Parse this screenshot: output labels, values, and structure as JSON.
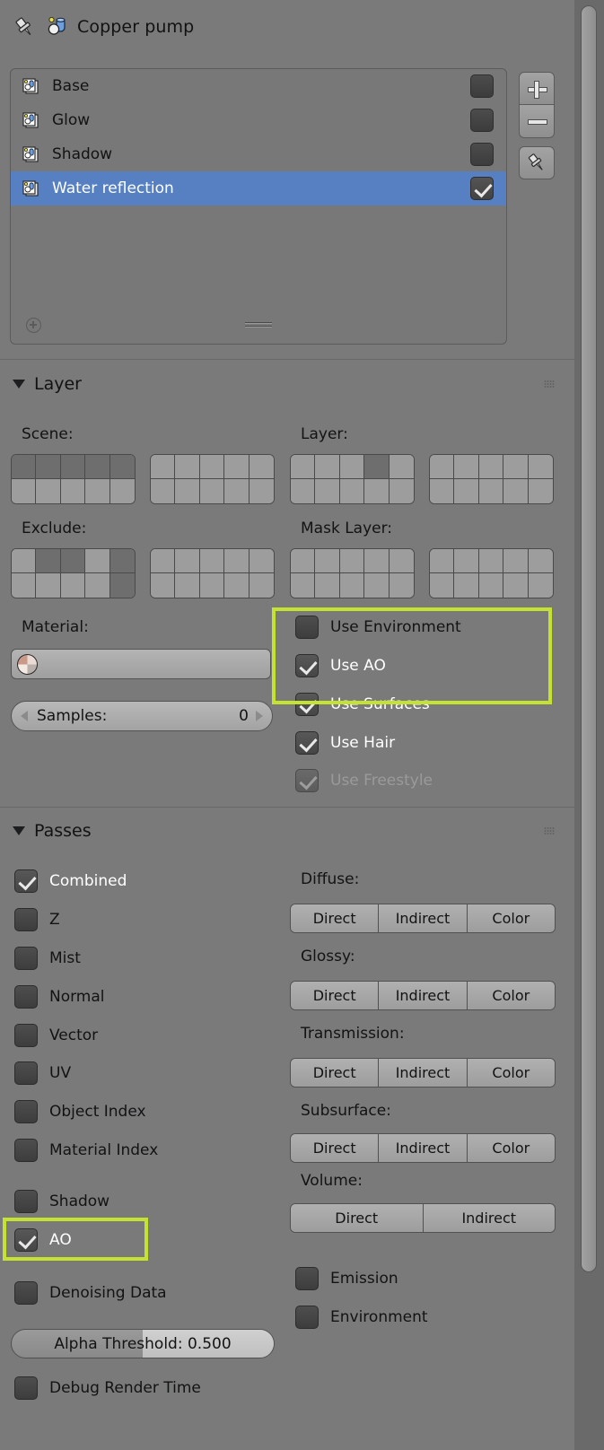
{
  "header": {
    "title": "Copper pump",
    "pin_icon": "pin-icon",
    "scene_icon": "render-layers-icon"
  },
  "render_layers": {
    "items": [
      {
        "name": "Base",
        "icon": "render-layer-icon",
        "enabled": false,
        "selected": false
      },
      {
        "name": "Glow",
        "icon": "render-layer-icon",
        "enabled": false,
        "selected": false
      },
      {
        "name": "Shadow",
        "icon": "render-layer-icon",
        "enabled": false,
        "selected": false
      },
      {
        "name": "Water reflection",
        "icon": "render-layer-icon",
        "enabled": true,
        "selected": true
      }
    ],
    "side_buttons": [
      {
        "label": "+",
        "name": "add-render-layer-button"
      },
      {
        "label": "−",
        "name": "remove-render-layer-button"
      },
      {
        "label": "",
        "name": "pin-render-layer-button"
      }
    ],
    "filter_icon": "filter-plus-icon",
    "resize_grip": "resize-grip"
  },
  "layer_panel": {
    "title": "Layer",
    "expanded": true,
    "groups": [
      {
        "label": "Scene:",
        "name": "scene-layers",
        "blocks": [
          {
            "cells": [
              true,
              true,
              true,
              true,
              true,
              false,
              false,
              false,
              false,
              false
            ]
          },
          {
            "cells": [
              false,
              false,
              false,
              false,
              false,
              false,
              false,
              false,
              false,
              false
            ]
          }
        ]
      },
      {
        "label": "Layer:",
        "name": "layer-layers",
        "blocks": [
          {
            "cells": [
              false,
              false,
              false,
              true,
              false,
              false,
              false,
              false,
              false,
              false
            ]
          },
          {
            "cells": [
              false,
              false,
              false,
              false,
              false,
              false,
              false,
              false,
              false,
              false
            ]
          }
        ]
      },
      {
        "label": "Exclude:",
        "name": "exclude-layers",
        "blocks": [
          {
            "cells": [
              false,
              true,
              true,
              false,
              true,
              false,
              false,
              false,
              false,
              true
            ]
          },
          {
            "cells": [
              false,
              false,
              false,
              false,
              false,
              false,
              false,
              false,
              false,
              false
            ]
          }
        ]
      },
      {
        "label": "Mask Layer:",
        "name": "mask-layers",
        "blocks": [
          {
            "cells": [
              false,
              false,
              false,
              false,
              false,
              false,
              false,
              false,
              false,
              false
            ]
          },
          {
            "cells": [
              false,
              false,
              false,
              false,
              false,
              false,
              false,
              false,
              false,
              false
            ]
          }
        ]
      }
    ],
    "material_label": "Material:",
    "material_value": "",
    "samples_label": "Samples:",
    "samples_value": "0",
    "options": [
      {
        "label": "Use Environment",
        "checked": false,
        "disabled": false,
        "highlighted": true
      },
      {
        "label": "Use AO",
        "checked": true,
        "disabled": false,
        "highlighted": true
      },
      {
        "label": "Use Surfaces",
        "checked": true,
        "disabled": false,
        "highlighted": false
      },
      {
        "label": "Use Hair",
        "checked": true,
        "disabled": false,
        "highlighted": false
      },
      {
        "label": "Use Freestyle",
        "checked": true,
        "disabled": true,
        "highlighted": false
      }
    ]
  },
  "passes_panel": {
    "title": "Passes",
    "expanded": true,
    "left_passes": [
      {
        "label": "Combined",
        "checked": true,
        "active": true,
        "highlighted": false
      },
      {
        "label": "Z",
        "checked": false,
        "active": false,
        "highlighted": false
      },
      {
        "label": "Mist",
        "checked": false,
        "active": false,
        "highlighted": false
      },
      {
        "label": "Normal",
        "checked": false,
        "active": false,
        "highlighted": false
      },
      {
        "label": "Vector",
        "checked": false,
        "active": false,
        "highlighted": false
      },
      {
        "label": "UV",
        "checked": false,
        "active": false,
        "highlighted": false
      },
      {
        "label": "Object Index",
        "checked": false,
        "active": false,
        "highlighted": false
      },
      {
        "label": "Material Index",
        "checked": false,
        "active": false,
        "highlighted": false
      },
      {
        "label": "Shadow",
        "checked": false,
        "active": false,
        "highlighted": false
      },
      {
        "label": "AO",
        "checked": true,
        "active": true,
        "highlighted": true
      },
      {
        "label": "Denoising Data",
        "checked": false,
        "active": false,
        "highlighted": false
      }
    ],
    "alpha_threshold": {
      "label": "Alpha Threshold: 0.500",
      "fill_percent": 50
    },
    "debug_pass": {
      "label": "Debug Render Time",
      "checked": false
    },
    "right_groups": [
      {
        "label": "Diffuse:",
        "buttons": [
          "Direct",
          "Indirect",
          "Color"
        ]
      },
      {
        "label": "Glossy:",
        "buttons": [
          "Direct",
          "Indirect",
          "Color"
        ]
      },
      {
        "label": "Transmission:",
        "buttons": [
          "Direct",
          "Indirect",
          "Color"
        ]
      },
      {
        "label": "Subsurface:",
        "buttons": [
          "Direct",
          "Indirect",
          "Color"
        ]
      },
      {
        "label": "Volume:",
        "buttons": [
          "Direct",
          "Indirect"
        ]
      }
    ],
    "right_checks": [
      {
        "label": "Emission",
        "checked": false
      },
      {
        "label": "Environment",
        "checked": false
      }
    ]
  },
  "colors": {
    "panel_bg": "#7a7a7a",
    "selection_blue": "#5680c2",
    "highlight_green": "#c3e330",
    "button_gray": "#a8a8a8",
    "text_dark": "#121315",
    "text_white": "#ffffff"
  }
}
